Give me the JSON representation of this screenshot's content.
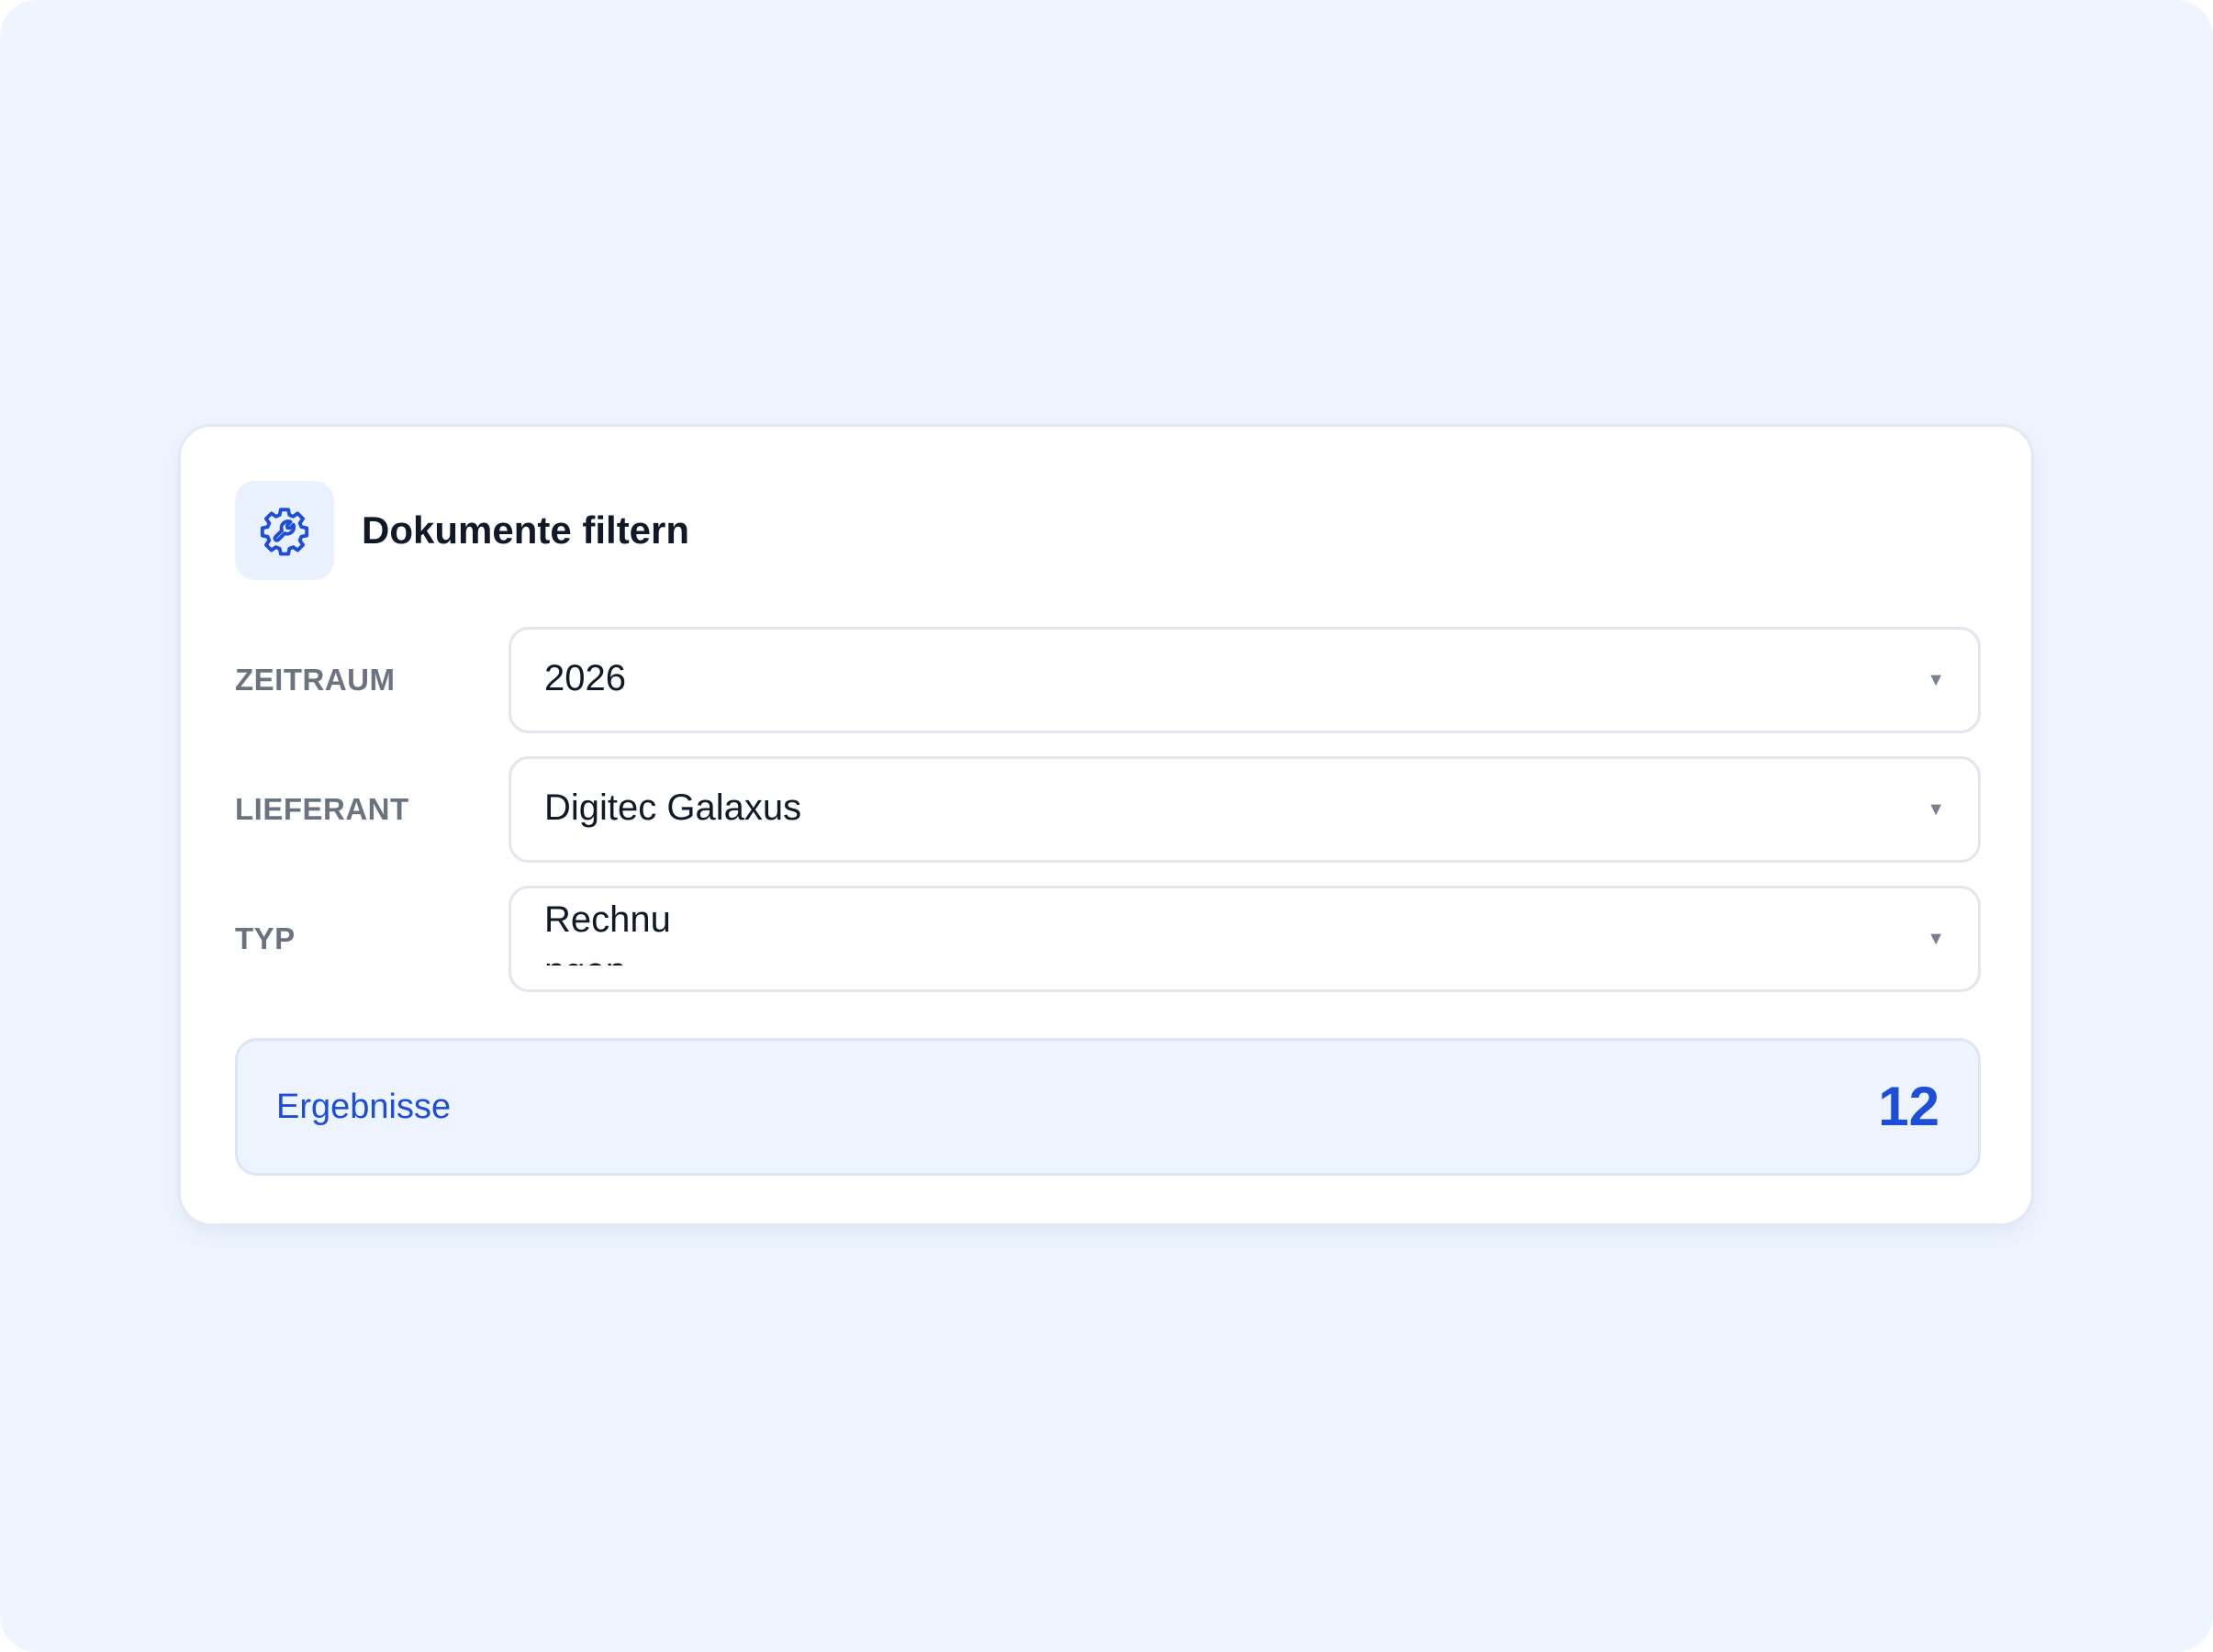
{
  "panel": {
    "title": "Dokumente filtern",
    "icon": "settings-gear-icon",
    "accent_color": "#1d4ed8"
  },
  "filters": [
    {
      "label": "ZEITRAUM",
      "value": "2026"
    },
    {
      "label": "LIEFERANT",
      "value": "Digitec Galaxus"
    },
    {
      "label": "TYP",
      "value": "Rechnungen"
    }
  ],
  "results": {
    "label": "Ergebnisse",
    "count": "12"
  }
}
